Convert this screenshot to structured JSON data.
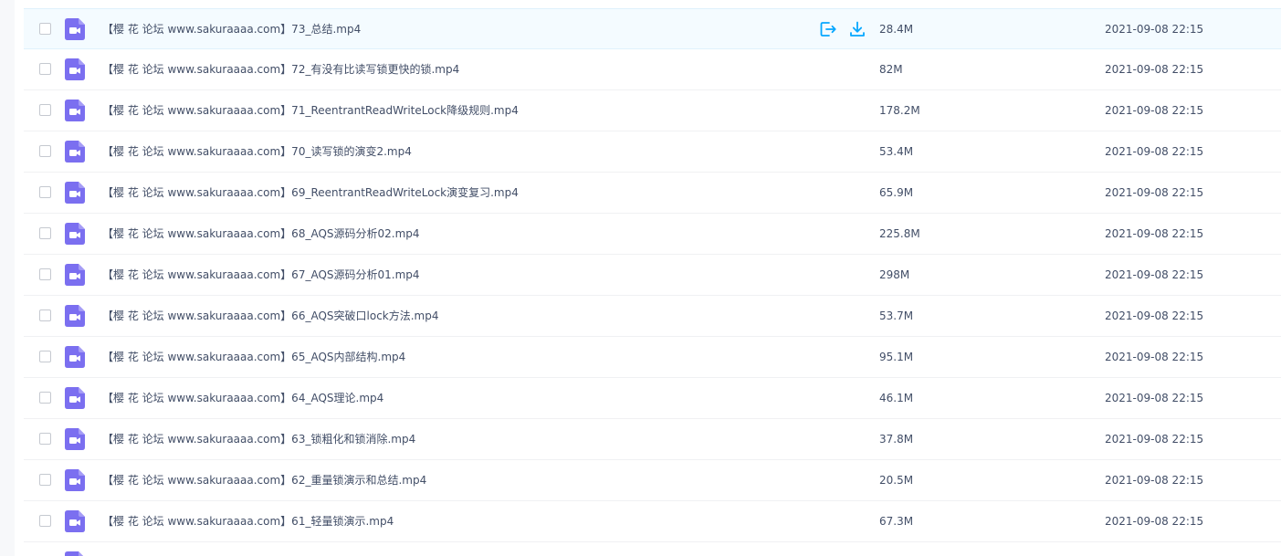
{
  "colors": {
    "accent": "#06a7ff",
    "video_icon": "#7b6ff0",
    "selected_row_bg": "#f4fbff",
    "text": "#424e67"
  },
  "row_actions": {
    "share_icon": "share-icon",
    "download_icon": "download-icon"
  },
  "files": [
    {
      "name": "【樱 花 论坛 www.sakuraaaa.com】73_总结.mp4",
      "size": "28.4M",
      "modified": "2021-09-08 22:15",
      "icon": "video-file-icon"
    },
    {
      "name": "【樱 花 论坛 www.sakuraaaa.com】72_有没有比读写锁更快的锁.mp4",
      "size": "82M",
      "modified": "2021-09-08 22:15",
      "icon": "video-file-icon"
    },
    {
      "name": "【樱 花 论坛 www.sakuraaaa.com】71_ReentrantReadWriteLock降级规则.mp4",
      "size": "178.2M",
      "modified": "2021-09-08 22:15",
      "icon": "video-file-icon"
    },
    {
      "name": "【樱 花 论坛 www.sakuraaaa.com】70_读写锁的演变2.mp4",
      "size": "53.4M",
      "modified": "2021-09-08 22:15",
      "icon": "video-file-icon"
    },
    {
      "name": "【樱 花 论坛 www.sakuraaaa.com】69_ReentrantReadWriteLock演变复习.mp4",
      "size": "65.9M",
      "modified": "2021-09-08 22:15",
      "icon": "video-file-icon"
    },
    {
      "name": "【樱 花 论坛 www.sakuraaaa.com】68_AQS源码分析02.mp4",
      "size": "225.8M",
      "modified": "2021-09-08 22:15",
      "icon": "video-file-icon"
    },
    {
      "name": "【樱 花 论坛 www.sakuraaaa.com】67_AQS源码分析01.mp4",
      "size": "298M",
      "modified": "2021-09-08 22:15",
      "icon": "video-file-icon"
    },
    {
      "name": "【樱 花 论坛 www.sakuraaaa.com】66_AQS突破口lock方法.mp4",
      "size": "53.7M",
      "modified": "2021-09-08 22:15",
      "icon": "video-file-icon"
    },
    {
      "name": "【樱 花 论坛 www.sakuraaaa.com】65_AQS内部结构.mp4",
      "size": "95.1M",
      "modified": "2021-09-08 22:15",
      "icon": "video-file-icon"
    },
    {
      "name": "【樱 花 论坛 www.sakuraaaa.com】64_AQS理论.mp4",
      "size": "46.1M",
      "modified": "2021-09-08 22:15",
      "icon": "video-file-icon"
    },
    {
      "name": "【樱 花 论坛 www.sakuraaaa.com】63_锁粗化和锁消除.mp4",
      "size": "37.8M",
      "modified": "2021-09-08 22:15",
      "icon": "video-file-icon"
    },
    {
      "name": "【樱 花 论坛 www.sakuraaaa.com】62_重量锁演示和总结.mp4",
      "size": "20.5M",
      "modified": "2021-09-08 22:15",
      "icon": "video-file-icon"
    },
    {
      "name": "【樱 花 论坛 www.sakuraaaa.com】61_轻量锁演示.mp4",
      "size": "67.3M",
      "modified": "2021-09-08 22:15",
      "icon": "video-file-icon"
    }
  ]
}
